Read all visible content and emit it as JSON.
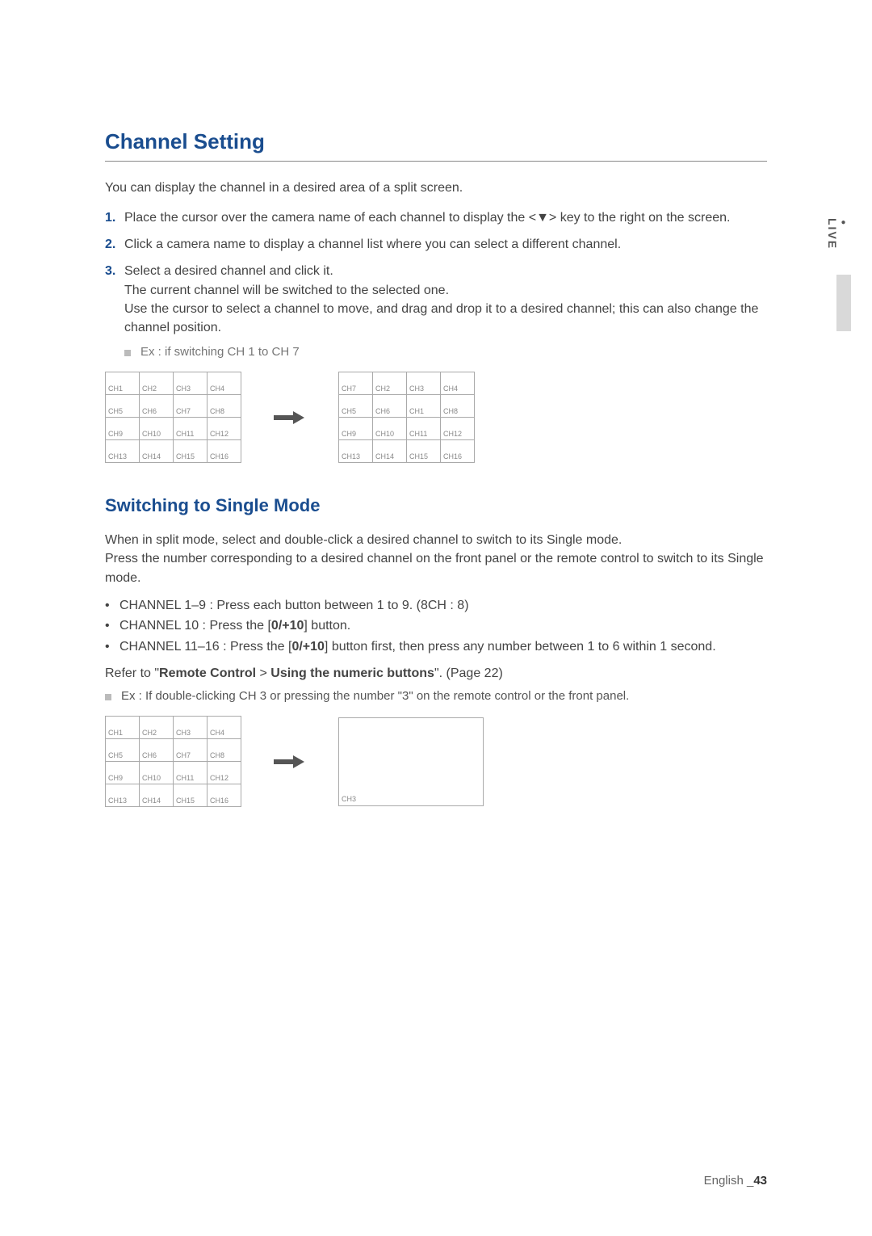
{
  "sideTab": "LIVE",
  "heading1": "Channel Setting",
  "intro1": "You can display the channel in a desired area of a split screen.",
  "steps": [
    {
      "num": "1.",
      "text": "Place the cursor over the camera name of each channel to display the <▼> key to the right on the screen."
    },
    {
      "num": "2.",
      "text": "Click a camera name to display a channel list where you can select a different channel."
    },
    {
      "num": "3.",
      "text": "Select a desired channel and click it.",
      "sub": [
        "The current channel will be switched to the selected one.",
        "Use the cursor to select a channel to move, and drag and drop it to a desired channel; this can also change the channel position."
      ]
    }
  ],
  "exNote1": "Ex : if switching CH 1 to CH 7",
  "gridBefore": [
    [
      "CH1",
      "CH2",
      "CH3",
      "CH4"
    ],
    [
      "CH5",
      "CH6",
      "CH7",
      "CH8"
    ],
    [
      "CH9",
      "CH10",
      "CH11",
      "CH12"
    ],
    [
      "CH13",
      "CH14",
      "CH15",
      "CH16"
    ]
  ],
  "gridAfter": [
    [
      "CH7",
      "CH2",
      "CH3",
      "CH4"
    ],
    [
      "CH5",
      "CH6",
      "CH1",
      "CH8"
    ],
    [
      "CH9",
      "CH10",
      "CH11",
      "CH12"
    ],
    [
      "CH13",
      "CH14",
      "CH15",
      "CH16"
    ]
  ],
  "heading2": "Switching to Single Mode",
  "body2a": "When in split mode, select and double-click a desired channel to switch to its Single mode.",
  "body2b": "Press the number corresponding to a desired channel on the front panel or the remote control to switch to its Single mode.",
  "bullets": [
    {
      "pre": "CHANNEL 1–9 : Press each button between 1 to 9. (8CH : 8)"
    },
    {
      "pre": "CHANNEL 10 : Press the [",
      "bold": "0/+10",
      "post": "] button."
    },
    {
      "pre": "CHANNEL 11–16 : Press the [",
      "bold": "0/+10",
      "post": "] button first, then press any number between 1 to 6 within 1 second."
    }
  ],
  "ref": {
    "pre": "Refer to \"",
    "b1": "Remote Control",
    "sep": " > ",
    "b2": "Using the numeric buttons",
    "post": "\". (Page 22)"
  },
  "exNote2": "Ex : If double-clicking CH 3 or pressing the number \"3\" on the remote control or the front panel.",
  "gridSingleBefore": [
    [
      "CH1",
      "CH2",
      "CH3",
      "CH4"
    ],
    [
      "CH5",
      "CH6",
      "CH7",
      "CH8"
    ],
    [
      "CH9",
      "CH10",
      "CH11",
      "CH12"
    ],
    [
      "CH13",
      "CH14",
      "CH15",
      "CH16"
    ]
  ],
  "singleLabel": "CH3",
  "footer": {
    "lang": "English _",
    "page": "43"
  }
}
